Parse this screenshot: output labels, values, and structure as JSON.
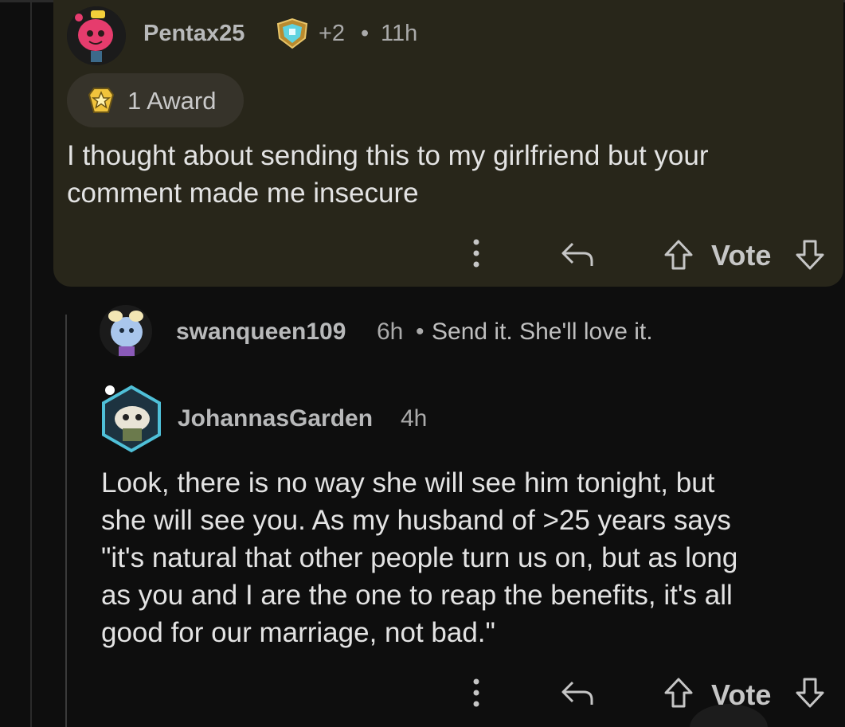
{
  "comments": [
    {
      "author": "Pentax25",
      "karma_badge": "+2",
      "separator": "•",
      "time": "11h",
      "awards_label": "1 Award",
      "body_lines": [
        "I thought about sending this to my girlfriend but your",
        "comment made me insecure"
      ],
      "vote_label": "Vote",
      "highlight_color": "#28261a"
    },
    {
      "author": "swanqueen109",
      "time": "6h",
      "separator": "•",
      "collapsed_preview": "Send it. She'll love it."
    },
    {
      "author": "JohannasGarden",
      "time": "4h",
      "body_lines": [
        "Look, there is no way she will see him tonight, but",
        "she will see you. As my husband of >25 years says",
        "\"it's natural that other people turn us on, but as long",
        "as you and I are the one to reap the benefits, it's all",
        "good for our marriage, not bad.\""
      ],
      "vote_label": "Vote"
    }
  ],
  "icons": {
    "more": "more-vertical-icon",
    "reply": "reply-arrow-icon",
    "upvote": "upvote-arrow-icon",
    "downvote": "downvote-arrow-icon",
    "award": "award-star-icon",
    "achievement": "achievement-shield-icon"
  },
  "colors": {
    "background": "#0e0e0e",
    "highlight": "#28261a",
    "text": "#e3e3e3",
    "muted": "#aaaaaa"
  }
}
